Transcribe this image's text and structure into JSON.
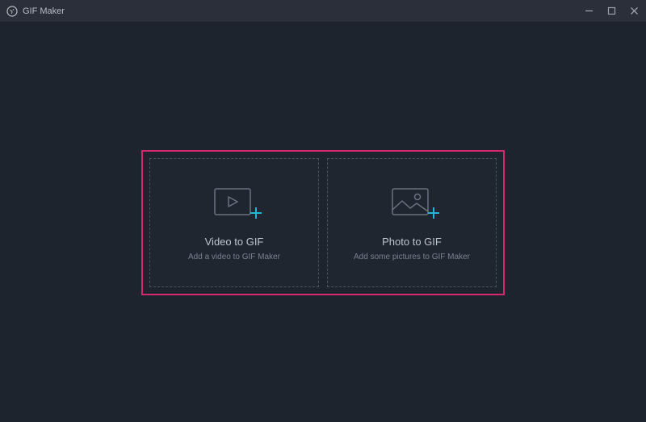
{
  "titlebar": {
    "app_title": "GIF Maker"
  },
  "options": {
    "video": {
      "title": "Video to GIF",
      "subtitle": "Add a video to GIF Maker"
    },
    "photo": {
      "title": "Photo to GIF",
      "subtitle": "Add some pictures to GIF Maker"
    }
  },
  "colors": {
    "highlight": "#d6286f",
    "accent": "#1fb9d6"
  }
}
